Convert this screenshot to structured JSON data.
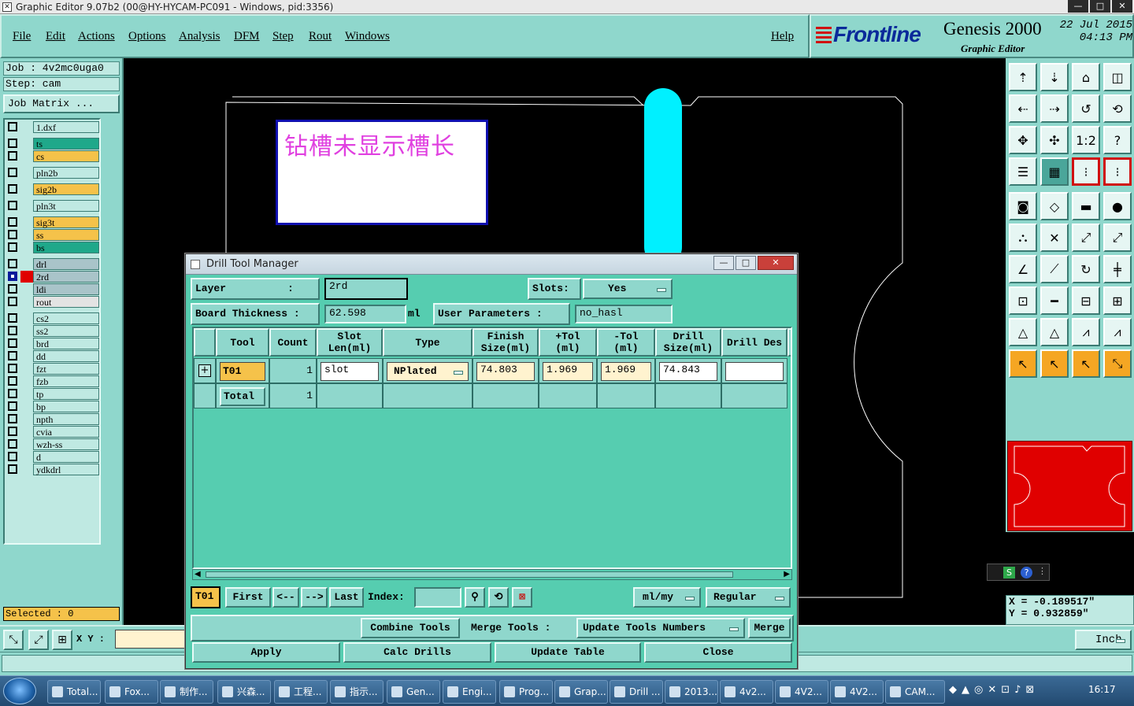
{
  "window": {
    "title": "Graphic Editor 9.07b2 (00@HY-HYCAM-PC091 - Windows, pid:3356)",
    "min": "—",
    "max": "□",
    "close": "✕"
  },
  "menu": {
    "items": [
      "File",
      "Edit",
      "Actions",
      "Options",
      "Analysis",
      "DFM",
      "Step",
      "Rout",
      "Windows"
    ],
    "help": "Help"
  },
  "brand": {
    "logo": "Frontline",
    "product": "Genesis 2000",
    "subtitle": "Graphic Editor",
    "date": "22 Jul 2015",
    "time": "04:13 PM"
  },
  "left_panel": {
    "job": "Job  :  4v2mc0uga0",
    "step": "Step:  cam",
    "job_matrix": "Job Matrix ...",
    "layers": [
      {
        "name": "1.dxf",
        "color": "#bfe9e2",
        "mark": "",
        "checked": false
      },
      {
        "name": "ts",
        "color": "#1fa88a",
        "mark": "",
        "checked": false
      },
      {
        "name": "cs",
        "color": "#f5c24a",
        "mark": "",
        "checked": false
      },
      {
        "name": "pln2b",
        "color": "#bfe9e2",
        "mark": "",
        "checked": false
      },
      {
        "name": "sig2b",
        "color": "#f5c24a",
        "mark": "",
        "checked": false
      },
      {
        "name": "pln3t",
        "color": "#bfe9e2",
        "mark": "",
        "checked": false
      },
      {
        "name": "sig3t",
        "color": "#f5c24a",
        "mark": "",
        "checked": false
      },
      {
        "name": "ss",
        "color": "#f5c24a",
        "mark": "",
        "checked": false
      },
      {
        "name": "bs",
        "color": "#1fa88a",
        "mark": "",
        "checked": false
      },
      {
        "name": "drl",
        "color": "#a9c4c9",
        "mark": "",
        "checked": false
      },
      {
        "name": "2rd",
        "color": "#a9c4c9",
        "mark": "#e00000",
        "checked": true
      },
      {
        "name": "ldi",
        "color": "#a9c4c9",
        "mark": "",
        "checked": false
      },
      {
        "name": "rout",
        "color": "#e3e3e3",
        "mark": "",
        "checked": false
      },
      {
        "name": "cs2",
        "color": "#bfe9e2",
        "mark": "",
        "checked": false
      },
      {
        "name": "ss2",
        "color": "#bfe9e2",
        "mark": "",
        "checked": false
      },
      {
        "name": "brd",
        "color": "#bfe9e2",
        "mark": "",
        "checked": false
      },
      {
        "name": "dd",
        "color": "#bfe9e2",
        "mark": "",
        "checked": false
      },
      {
        "name": "fzt",
        "color": "#bfe9e2",
        "mark": "",
        "checked": false
      },
      {
        "name": "fzb",
        "color": "#bfe9e2",
        "mark": "",
        "checked": false
      },
      {
        "name": "tp",
        "color": "#bfe9e2",
        "mark": "",
        "checked": false
      },
      {
        "name": "bp",
        "color": "#bfe9e2",
        "mark": "",
        "checked": false
      },
      {
        "name": "npth",
        "color": "#bfe9e2",
        "mark": "",
        "checked": false
      },
      {
        "name": "cvia",
        "color": "#bfe9e2",
        "mark": "",
        "checked": false
      },
      {
        "name": "wzh-ss",
        "color": "#bfe9e2",
        "mark": "",
        "checked": false
      },
      {
        "name": "d",
        "color": "#bfe9e2",
        "mark": "",
        "checked": false
      },
      {
        "name": "ydkdrl",
        "color": "#bfe9e2",
        "mark": "",
        "checked": false
      }
    ],
    "selected": "Selected : 0"
  },
  "canvas": {
    "note": "钻槽未显示槽长"
  },
  "bottom": {
    "xy_label": "X Y :",
    "xy_value": "",
    "units": "Inch"
  },
  "coords": {
    "x": "X = -0.189517\"",
    "y": "Y = 0.932859\""
  },
  "dialog": {
    "title": "Drill Tool Manager",
    "layer_label": "Layer          :",
    "layer_value": "2rd",
    "slots_label": "Slots:",
    "slots_value": "Yes",
    "thickness_label": "Board Thickness :",
    "thickness_value": "62.598",
    "thickness_unit": "ml",
    "user_params_label": "User Parameters :",
    "user_params_value": "no_hasl",
    "columns": [
      "Tool",
      "Count",
      "Slot Len(ml)",
      "Type",
      "Finish Size(ml)",
      "+Tol (ml)",
      "-Tol (ml)",
      "Drill Size(ml)",
      "Drill Des"
    ],
    "row": {
      "tool": "T01",
      "count": "1",
      "slot_len": "slot",
      "type": "NPlated",
      "finish": "74.803",
      "ptol": "1.969",
      "ntol": "1.969",
      "drill_size": "74.843",
      "drill_des": ""
    },
    "total": {
      "label": "Total",
      "count": "1"
    },
    "nav": {
      "current": "T01",
      "first": "First",
      "prev": "<--",
      "next": "-->",
      "last": "Last",
      "index_label": "Index:",
      "index_value": "",
      "units": "ml/my",
      "mode": "Regular"
    },
    "buttons": {
      "combine": "Combine Tools",
      "merge_label": "Merge Tools :",
      "update_numbers": "Update Tools Numbers",
      "merge": "Merge",
      "apply": "Apply",
      "calc": "Calc Drills",
      "update_table": "Update Table",
      "close": "Close"
    }
  },
  "taskbar": {
    "items": [
      "Total...",
      "Fox...",
      "制作...",
      "兴森...",
      "工程...",
      "指示...",
      "Gen...",
      "Engi...",
      "Prog...",
      "Grap...",
      "Drill ...",
      "2013...",
      "4v2...",
      "4V2...",
      "4V2...",
      "CAM..."
    ],
    "clock": "16:17"
  }
}
